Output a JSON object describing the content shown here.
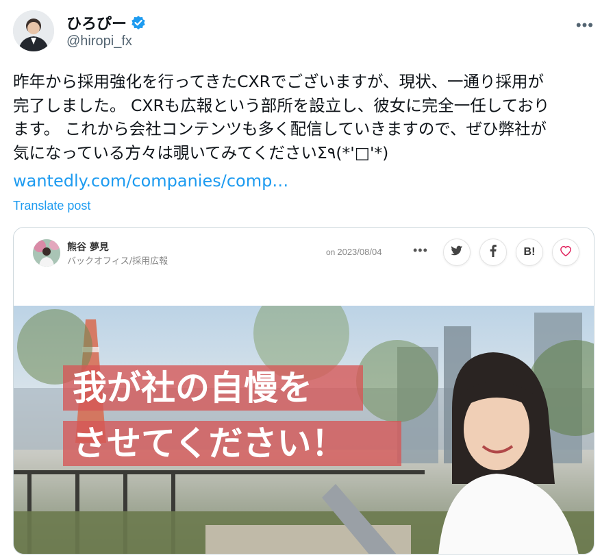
{
  "tweet": {
    "display_name": "ひろぴー",
    "handle": "@hiropi_fx",
    "more_glyph": "•••",
    "text": "昨年から採用強化を行ってきたCXRでございますが、現状、一通り採用が\n完了しました。 CXRも広報という部所を設立し、彼女に完全一任しており\nます。 これから会社コンテンツも多く配信していきますので、ぜひ弊社が\n気になっている方々は覗いてみてくださいΣ٩(*'□'*)",
    "link": "wantedly.com/companies/comp…",
    "translate": "Translate post"
  },
  "card": {
    "author_name": "熊谷 夢見",
    "author_role": "バックオフィス/採用広報",
    "date_prefix": "on",
    "date": "2023/08/04",
    "more_glyph": "•••",
    "hatena_label": "B!",
    "hero_line1": "我が社の自慢を",
    "hero_line2": "させてください！"
  },
  "colors": {
    "accent": "#1d9bf0",
    "text": "#0f1419",
    "secondary": "#536471",
    "caption_bg": "#d65656",
    "like": "#e0245e"
  },
  "icons": {
    "verified": "verified-badge-icon",
    "twitter": "twitter-bird-icon",
    "facebook": "facebook-icon",
    "like": "heart-icon"
  }
}
